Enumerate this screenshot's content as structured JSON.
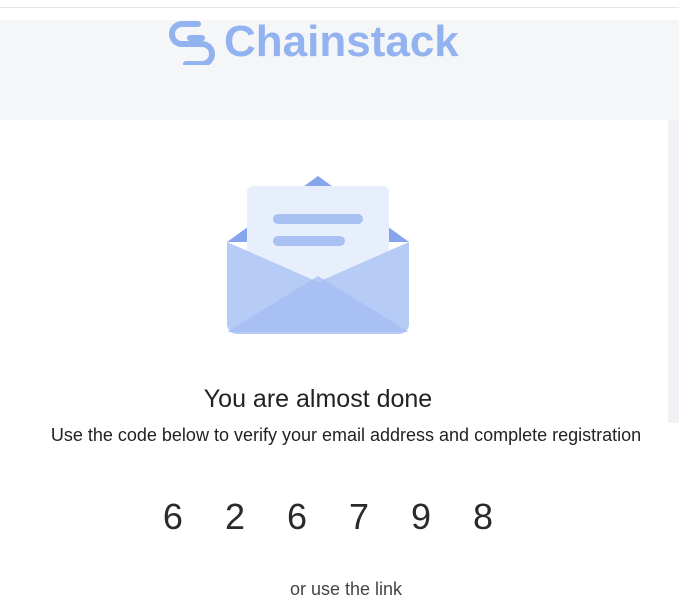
{
  "header": {
    "brand_name": "Chainstack",
    "brand_color": "#93b2f0"
  },
  "illustration": {
    "icon": "open-envelope-icon"
  },
  "main": {
    "heading": "You are almost done",
    "instruction": "Use the code below to verify your email address and complete registration",
    "code": "6 2 6 7 9 8",
    "alt_text": "or use the link"
  },
  "colors": {
    "accent": "#93b2f0",
    "link": "#3d6fd8",
    "text": "#222222"
  }
}
